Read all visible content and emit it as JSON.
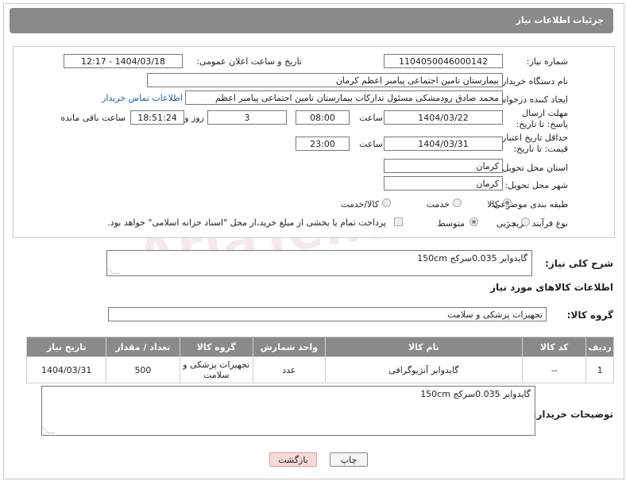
{
  "header": {
    "title": "جزئیات اطلاعات نیاز"
  },
  "fields": {
    "need_number_label": "شماره نیاز:",
    "need_number": "1104050046000142",
    "announce_label": "تاریخ و ساعت اعلان عمومی:",
    "announce_value": "1404/03/18 - 12:17",
    "buyer_org_label": "نام دستگاه خریدار:",
    "buyer_org": "بیمارستان تامین اجتماعی پیامبر اعظم کرمان",
    "creator_label": "ایجاد کننده درخواست:",
    "creator": "محمد صادق  رودمشکی مسئول تدارکات بیمارستان تامین اجتماعی پیامبر اعظم",
    "contact_link": "اطلاعات تماس خریدار",
    "deadline_label": "مهلت ارسال پاسخ: تا تاریخ:",
    "deadline_date": "1404/03/22",
    "hour_label": "ساعت",
    "deadline_time": "08:00",
    "days": "3",
    "days_label": "روز و",
    "remaining_time": "18:51:24",
    "remaining_label": "ساعت باقی مانده",
    "min_valid_label": "حداقل تاریخ اعتبار قیمت: تا تاریخ:",
    "valid_date": "1404/03/31",
    "valid_hour_label": "ساعت",
    "valid_time": "23:00",
    "delivery_province_label": "استان محل تحویل:",
    "delivery_province": "کرمان",
    "delivery_city_label": "شهر محل تحویل:",
    "delivery_city": "کرمان",
    "category_label": "طبقه بندی موضوعی:",
    "category_options": [
      "کالا",
      "خدمت",
      "کالا/خدمت"
    ],
    "process_label": "نوع فرآیند خرید :",
    "process_options": [
      "جزیی",
      "متوسط"
    ],
    "payment_note": "پرداخت تمام یا بخشی از مبلغ خرید،از محل \"اسناد خزانه اسلامی\" خواهد بود."
  },
  "description": {
    "label": "شرح کلی نیاز:",
    "value": "گایدوایر 0.035سرکج 150cm"
  },
  "goods_info_title": "اطلاعات کالاهای مورد نیاز",
  "goods_group": {
    "label": "گروه کالا:",
    "value": "تجهیزات پزشکی و سلامت"
  },
  "table": {
    "headers": [
      "ردیف",
      "کد کالا",
      "نام کالا",
      "واحد شمارش",
      "گروه کالا",
      "تعداد / مقدار",
      "تاریخ نیاز"
    ],
    "rows": [
      [
        "1",
        "--",
        "گایدوایر آنژیوگرافی",
        "عدد",
        "تجهیزات پزشکی و سلامت",
        "500",
        "1404/03/31"
      ]
    ]
  },
  "buyer_notes": {
    "label": "توضیحات خریدار:",
    "value": "گایدوایر 0.035سرکج 150cm"
  },
  "buttons": {
    "print": "چاپ",
    "back": "بازگشت"
  },
  "watermark": "AriaTender.neT",
  "colors": {
    "header_bg": "#8a8a8a",
    "link": "#1f5fb0",
    "back_button": "#f7d9d9"
  }
}
